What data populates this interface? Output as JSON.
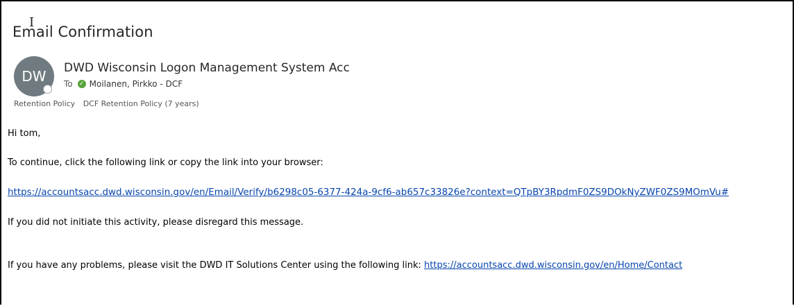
{
  "email": {
    "subject": "Email Confirmation",
    "sender": {
      "initials": "DW",
      "name": "DWD Wisconsin Logon Management System Acc"
    },
    "to": {
      "label": "To",
      "recipient": "Moilanen, Pirkko - DCF"
    },
    "retention": {
      "label": "Retention Policy",
      "value": "DCF Retention Policy (7 years)"
    },
    "body": {
      "greeting": "Hi tom,",
      "instruction": "To continue, click the following link or copy the link into your browser:",
      "verify_link": "https://accountsacc.dwd.wisconsin.gov/en/Email/Verify/b6298c05-6377-424a-9cf6-ab657c33826e?context=QTpBY3RpdmF0ZS9DOkNyZWF0ZS9MOmVu#",
      "disregard": "If you did not initiate this activity, please disregard this message.",
      "problems_text": "If you have any problems, please visit the DWD IT Solutions Center using the following link: ",
      "contact_link": "https://accountsacc.dwd.wisconsin.gov/en/Home/Contact"
    }
  },
  "icons": {
    "presence": "presence-status-icon",
    "recipient_status": "check-circle-icon",
    "cursor": "text-cursor-icon"
  },
  "colors": {
    "avatar_bg": "#6f7b80",
    "link": "#0645ad",
    "status_green": "#58a33a"
  }
}
